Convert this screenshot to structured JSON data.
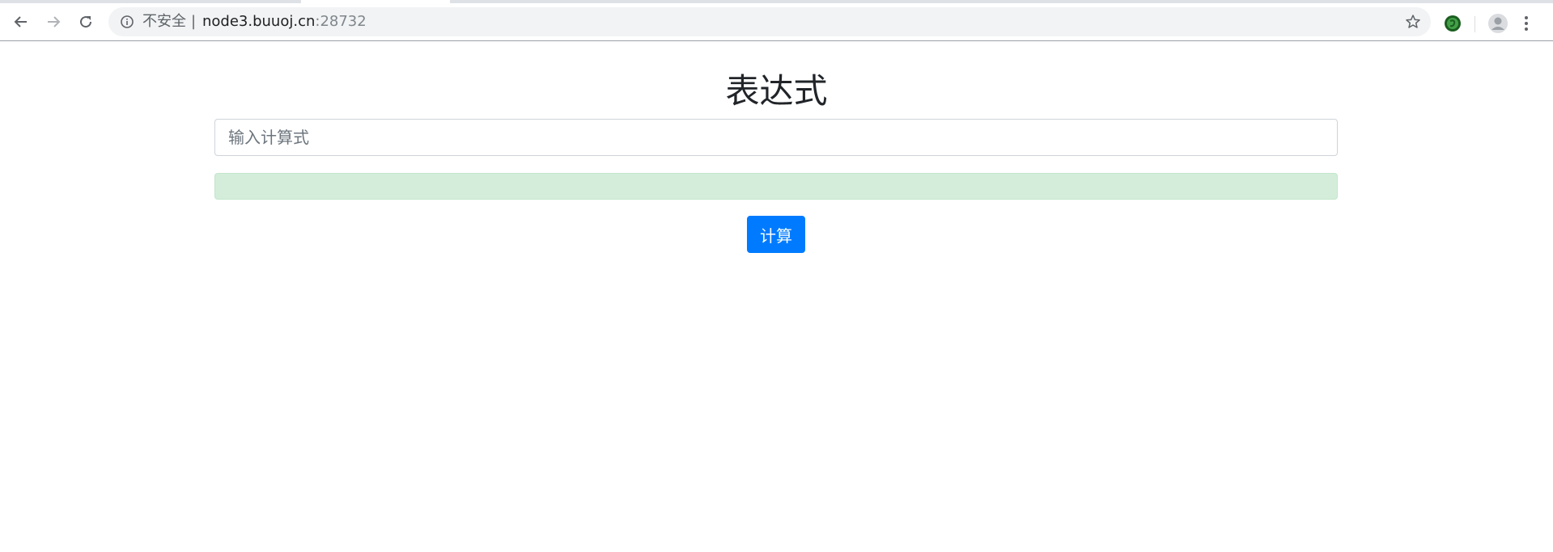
{
  "browser": {
    "security_label": "不安全",
    "separator": "|",
    "url_host": "node3.buuoj.cn",
    "url_port": ":28732"
  },
  "page": {
    "title": "表达式",
    "input_placeholder": "输入计算式",
    "input_value": "",
    "result_text": "",
    "button_label": "计算"
  },
  "colors": {
    "primary": "#007bff",
    "success_bg": "#d4edda",
    "extension_green": "#2e7d32"
  },
  "icons": {
    "back": "back-arrow-icon",
    "forward": "forward-arrow-icon",
    "reload": "reload-icon",
    "info": "info-icon",
    "bookmark": "star-icon",
    "extension": "extension-icon",
    "profile": "avatar-icon",
    "menu": "kebab-menu-icon"
  }
}
